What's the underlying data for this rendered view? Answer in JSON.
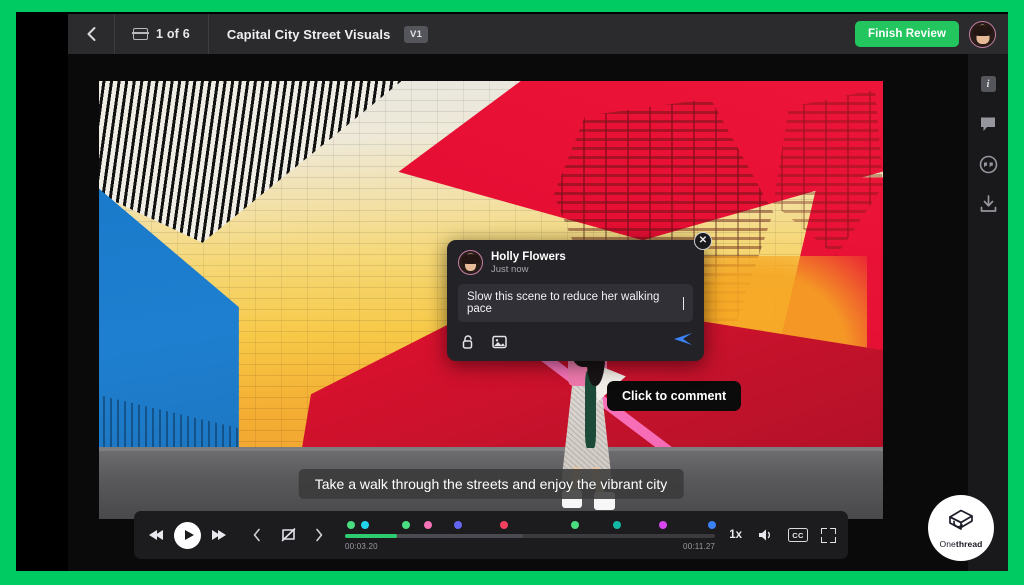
{
  "brand": {
    "frame_color": "#00CB62",
    "logo_name": "onethread-logo",
    "logo_text_light": "One",
    "logo_text_bold": "thread"
  },
  "header": {
    "back_icon": "chevron-left-icon",
    "slate_icon": "clip-slate-icon",
    "count_label": "1 of 6",
    "title": "Capital City Street Visuals",
    "version_chip": "V1",
    "finish_button": "Finish Review",
    "finish_button_color": "#22C55E",
    "avatar_name": "user-avatar"
  },
  "rail": {
    "items": [
      {
        "icon": "info-icon",
        "glyph": "i"
      },
      {
        "icon": "comment-bubble-icon"
      },
      {
        "icon": "emoji-reaction-icon"
      },
      {
        "icon": "download-icon"
      }
    ]
  },
  "video": {
    "caption": "Take a walk through the streets and enjoy the vibrant city",
    "click_tooltip": "Click to comment",
    "cursor_icon": "cursor-arrow-icon"
  },
  "comment_popup": {
    "author": "Holly Flowers",
    "timestamp": "Just now",
    "draft_text": "Slow this scene to reduce her walking pace",
    "close_icon": "close-icon",
    "tools": [
      {
        "icon": "unlock-icon"
      },
      {
        "icon": "image-attach-icon"
      }
    ],
    "send_icon": "send-icon",
    "send_color": "#3B82F6"
  },
  "player": {
    "prev_icon": "skip-previous-icon",
    "play_icon": "play-icon",
    "next_icon": "skip-next-icon",
    "prev_marker_icon": "chevron-left-icon",
    "marker_icon": "flag-off-icon",
    "next_marker_icon": "chevron-right-icon",
    "current_time": "00:03.20",
    "total_time": "00:11.27",
    "progress_percent": 14,
    "buffer_percent": 48,
    "speed": "1x",
    "volume_icon": "volume-icon",
    "cc_label": "CC",
    "cc_icon": "closed-caption-icon",
    "fullscreen_icon": "fullscreen-icon",
    "markers": [
      {
        "position": 1.5,
        "color": "#4ADE80"
      },
      {
        "position": 5.5,
        "color": "#22D3EE"
      },
      {
        "position": 16.5,
        "color": "#4ADE80"
      },
      {
        "position": 22.5,
        "color": "#F472B6"
      },
      {
        "position": 30.5,
        "color": "#6366F1"
      },
      {
        "position": 43.0,
        "color": "#F43F5E"
      },
      {
        "position": 62.0,
        "color": "#4ADE80"
      },
      {
        "position": 73.5,
        "color": "#14B8A6"
      },
      {
        "position": 86.0,
        "color": "#D946EF"
      },
      {
        "position": 99.0,
        "color": "#3B82F6"
      }
    ]
  }
}
